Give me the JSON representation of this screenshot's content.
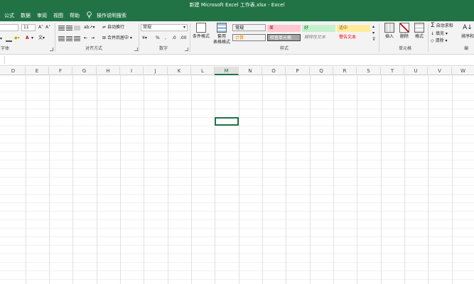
{
  "window": {
    "title": "新建 Microsoft Excel 工作表.xlsx  -  Excel"
  },
  "menu": {
    "tabs": [
      "公式",
      "数据",
      "审阅",
      "视图",
      "帮助"
    ],
    "tell_me": "操作说明搜索"
  },
  "ribbon": {
    "font": {
      "size": "11",
      "group_label": "字体"
    },
    "alignment": {
      "wrap_text": "自动换行",
      "merge_center": "合并后居中",
      "group_label": "对齐方式"
    },
    "number": {
      "format": "常规",
      "group_label": "数字"
    },
    "styles": {
      "conditional_format": "条件格式",
      "table_format_1": "套用",
      "table_format_2": "表格格式",
      "cells": [
        {
          "label": "常规",
          "bg": "#ffffff",
          "fg": "#000000"
        },
        {
          "label": "差",
          "bg": "#ffc7ce",
          "fg": "#9c0006"
        },
        {
          "label": "好",
          "bg": "#c6efce",
          "fg": "#006100"
        },
        {
          "label": "适中",
          "bg": "#ffeb9c",
          "fg": "#9c5700"
        },
        {
          "label": "计算",
          "bg": "#f2f2f2",
          "fg": "#fa7d00"
        },
        {
          "label": "检查单元格",
          "bg": "#a5a5a5",
          "fg": "#ffffff"
        },
        {
          "label": "解释性文本",
          "bg": "#ffffff",
          "fg": "#7f7f7f"
        },
        {
          "label": "警告文本",
          "bg": "#ffffff",
          "fg": "#ff0000"
        }
      ],
      "group_label": "样式"
    },
    "cells": {
      "insert": "插入",
      "delete": "删除",
      "format": "格式",
      "group_label": "单元格"
    },
    "editing": {
      "autosum": "自动求和",
      "fill": "填充",
      "clear": "清除",
      "sort_filter": "排序和",
      "group_label": "编"
    }
  },
  "sheet": {
    "columns": [
      "D",
      "E",
      "F",
      "G",
      "H",
      "I",
      "J",
      "K",
      "L",
      "M",
      "N",
      "O",
      "P",
      "Q",
      "R",
      "S",
      "T",
      "U",
      "V",
      "W"
    ],
    "selected_column": "M"
  },
  "colors": {
    "accent": "#217346"
  }
}
